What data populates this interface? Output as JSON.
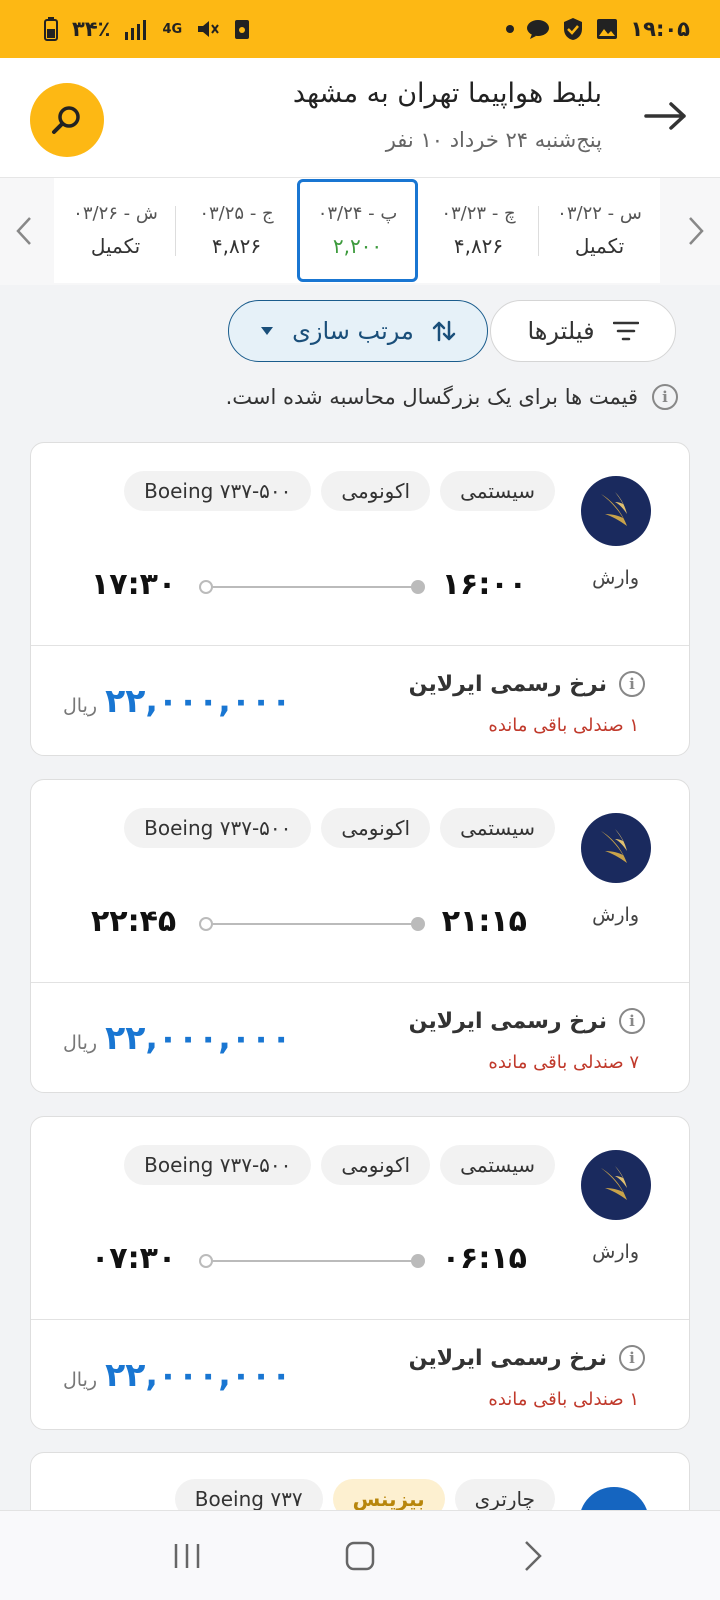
{
  "status_bar": {
    "time": "۱۹:۰۵",
    "battery_percent": "۳۴٪",
    "network": "4G"
  },
  "header": {
    "title": "بلیط هواپیما تهران به مشهد",
    "subtitle": "پنج‌شنبه ۲۴ خرداد ۱۰ نفر"
  },
  "dates": [
    {
      "label": "س - ۰۳/۲۲",
      "price": "تکمیل",
      "selected": false
    },
    {
      "label": "چ - ۰۳/۲۳",
      "price": "۴,۸۲۶",
      "selected": false
    },
    {
      "label": "پ - ۰۳/۲۴",
      "price": "۲,۲۰۰",
      "selected": true
    },
    {
      "label": "ج - ۰۳/۲۵",
      "price": "۴,۸۲۶",
      "selected": false
    },
    {
      "label": "ش - ۰۳/۲۶",
      "price": "تکمیل",
      "selected": false
    }
  ],
  "filters": {
    "filter_label": "فیلترها",
    "sort_label": "مرتب سازی"
  },
  "price_note": "قیمت ها برای یک بزرگسال محاسبه شده است.",
  "flights": [
    {
      "airline": "وارش",
      "type": "سیستمی",
      "cabin": "اکونومی",
      "aircraft": "Boeing ۷۳۷-۵۰۰",
      "departure": "۱۶:۰۰",
      "arrival": "۱۷:۳۰",
      "fare_label": "نرخ رسمی ایرلاین",
      "seats_left": "۱ صندلی باقی مانده",
      "price": "۲۲,۰۰۰,۰۰۰",
      "currency": "ریال"
    },
    {
      "airline": "وارش",
      "type": "سیستمی",
      "cabin": "اکونومی",
      "aircraft": "Boeing ۷۳۷-۵۰۰",
      "departure": "۲۱:۱۵",
      "arrival": "۲۲:۴۵",
      "fare_label": "نرخ رسمی ایرلاین",
      "seats_left": "۷ صندلی باقی مانده",
      "price": "۲۲,۰۰۰,۰۰۰",
      "currency": "ریال"
    },
    {
      "airline": "وارش",
      "type": "سیستمی",
      "cabin": "اکونومی",
      "aircraft": "Boeing ۷۳۷-۵۰۰",
      "departure": "۰۶:۱۵",
      "arrival": "۰۷:۳۰",
      "fare_label": "نرخ رسمی ایرلاین",
      "seats_left": "۱ صندلی باقی مانده",
      "price": "۲۲,۰۰۰,۰۰۰",
      "currency": "ریال"
    }
  ],
  "partial_flight": {
    "type": "چارتری",
    "cabin": "بیزینس",
    "aircraft": "Boeing ۷۳۷"
  },
  "colors": {
    "brand_yellow": "#FDB814",
    "price_blue": "#1976D2",
    "seats_red": "#c0392b",
    "selected_price_green": "#3c9a3c"
  }
}
